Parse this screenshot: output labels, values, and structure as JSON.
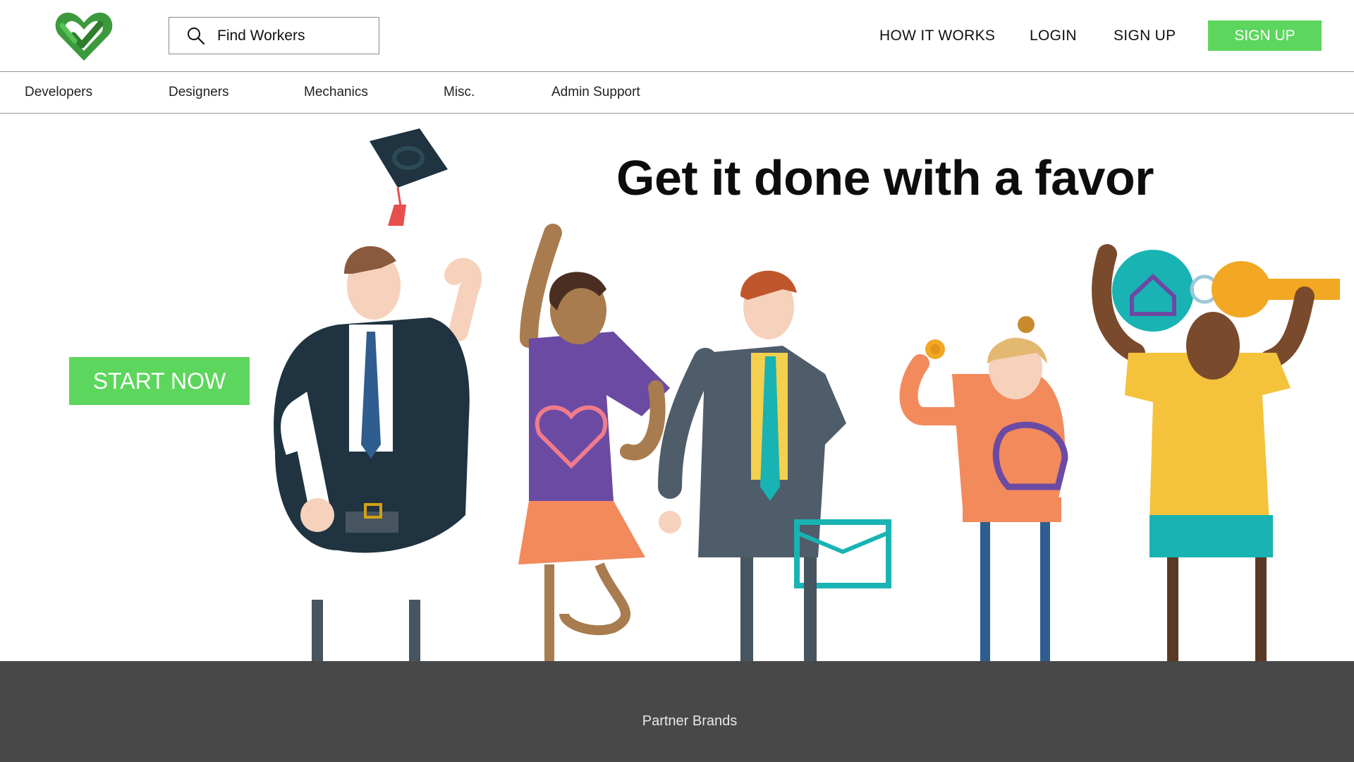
{
  "header": {
    "search": {
      "placeholder": "Find Workers",
      "value": ""
    },
    "nav": {
      "how_it_works": "HOW IT WORKS",
      "login": "LOGIN",
      "sign_up": "SIGN UP",
      "sign_up_button": "SIGN UP"
    }
  },
  "categories": [
    "Developers",
    "Designers",
    "Mechanics",
    "Misc.",
    "Admin Support"
  ],
  "hero": {
    "title": "Get it done with a favor",
    "cta": "START NOW"
  },
  "footer": {
    "label": "Partner Brands"
  },
  "colors": {
    "accent_green": "#5cd65c",
    "logo_green": "#3c9a3c",
    "footer_bg": "#484848"
  },
  "icons": [
    "heart-check-logo-icon",
    "search-icon"
  ]
}
